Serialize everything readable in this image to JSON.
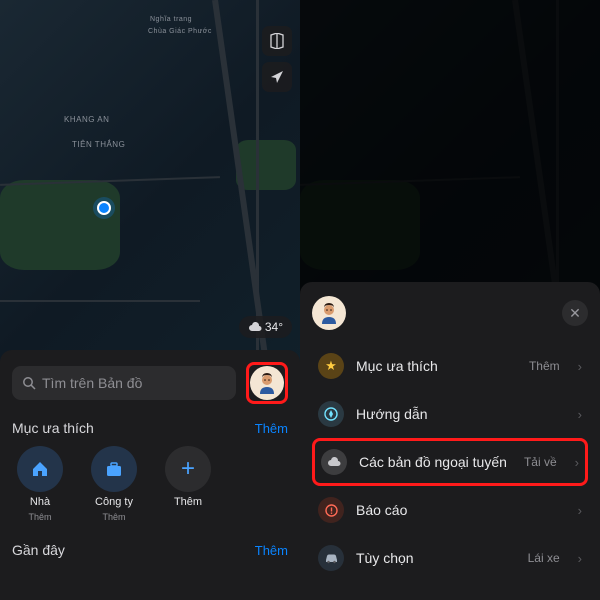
{
  "left": {
    "map_labels": {
      "khang_an": "KHANG AN",
      "tien_thang": "TIÊN THẮNG",
      "nghia_trang": "Nghĩa trang",
      "chua": "Chùa Giác Phước"
    },
    "weather": "34°",
    "search_placeholder": "Tìm trên Bản đồ",
    "favorites_title": "Mục ưa thích",
    "more_link": "Thêm",
    "favorites": [
      {
        "label": "Nhà",
        "sub": "Thêm"
      },
      {
        "label": "Công ty",
        "sub": "Thêm"
      },
      {
        "label": "Thêm",
        "sub": ""
      }
    ],
    "recent_title": "Gần đây",
    "recent_link": "Thêm"
  },
  "right": {
    "menu": [
      {
        "label": "Mục ưa thích",
        "action": "Thêm"
      },
      {
        "label": "Hướng dẫn",
        "action": ""
      },
      {
        "label": "Các bản đồ ngoại tuyến",
        "action": "Tải về"
      },
      {
        "label": "Báo cáo",
        "action": ""
      },
      {
        "label": "Tùy chọn",
        "action": "Lái xe"
      }
    ]
  }
}
